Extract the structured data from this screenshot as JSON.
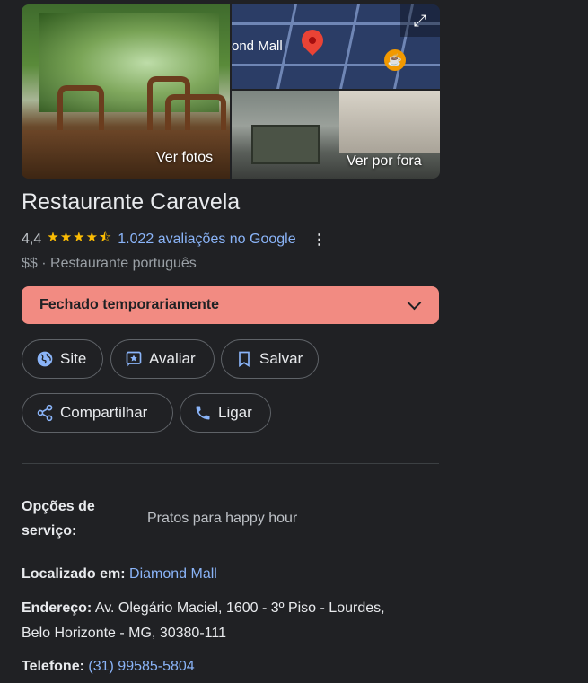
{
  "media": {
    "left_photo_label": "Ver fotos",
    "map_label": "ond Mall",
    "street_label": "Ver por fora",
    "expand_icon": "expand-icon"
  },
  "place": {
    "name": "Restaurante Caravela",
    "rating": "4,4",
    "rating_value": 4.4,
    "stars": "★★★★⯪",
    "reviews_link": "1.022 avaliações no Google",
    "more_icon": "⋮",
    "price_level": "$$",
    "separator": " · ",
    "category": "Restaurante português"
  },
  "status": {
    "label": "Fechado temporariamente",
    "color": "#f28b82"
  },
  "actions": {
    "site": "Site",
    "review": "Avaliar",
    "save": "Salvar",
    "share": "Compartilhar",
    "call": "Ligar"
  },
  "details": {
    "service_label_line1": "Opções de",
    "service_label_line2": "serviço:",
    "service_value": "Pratos para happy hour",
    "located_label": "Localizado em:",
    "located_value": "Diamond Mall",
    "address_label": "Endereço:",
    "address_line1": "Av. Olegário Maciel, 1600 - 3º Piso - Lourdes,",
    "address_line2": "Belo Horizonte - MG, 30380-111",
    "phone_label": "Telefone:",
    "phone_value": "(31) 99585-5804"
  },
  "colors": {
    "background": "#202124",
    "link": "#8ab4f8",
    "star": "#fbbc04"
  }
}
